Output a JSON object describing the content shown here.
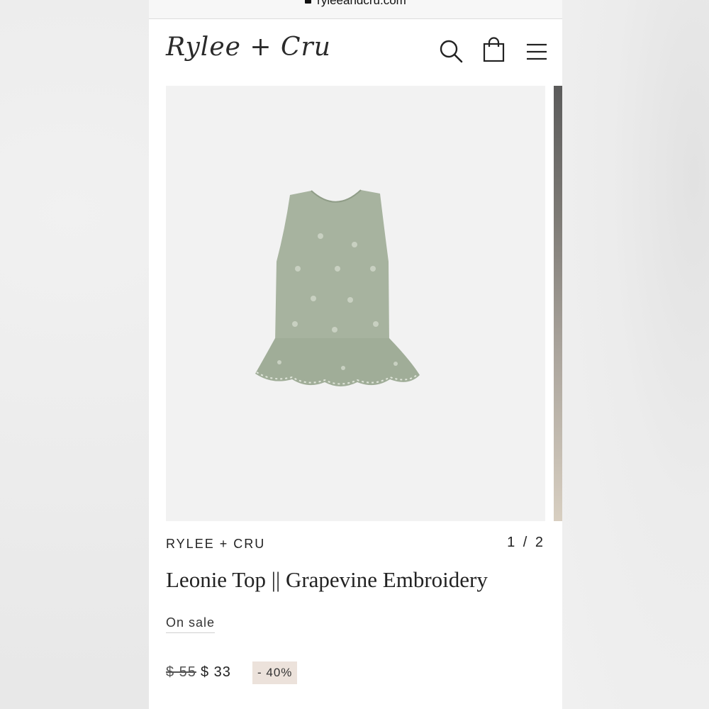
{
  "browser": {
    "url": "ryleeandcru.com"
  },
  "header": {
    "logo_text": "Rylee + Cru",
    "icons": [
      "search-icon",
      "shopping-bag-icon",
      "menu-icon"
    ]
  },
  "gallery": {
    "counter": "1 / 2",
    "background_color": "#f2f2f2",
    "product_color": "#a7b39f"
  },
  "product": {
    "brand": "RYLEE + CRU",
    "title": "Leonie Top || Grapevine Embroidery",
    "sale_label": "On sale",
    "original_price": "$ 55",
    "sale_price": "$ 33",
    "discount": "- 40%"
  }
}
